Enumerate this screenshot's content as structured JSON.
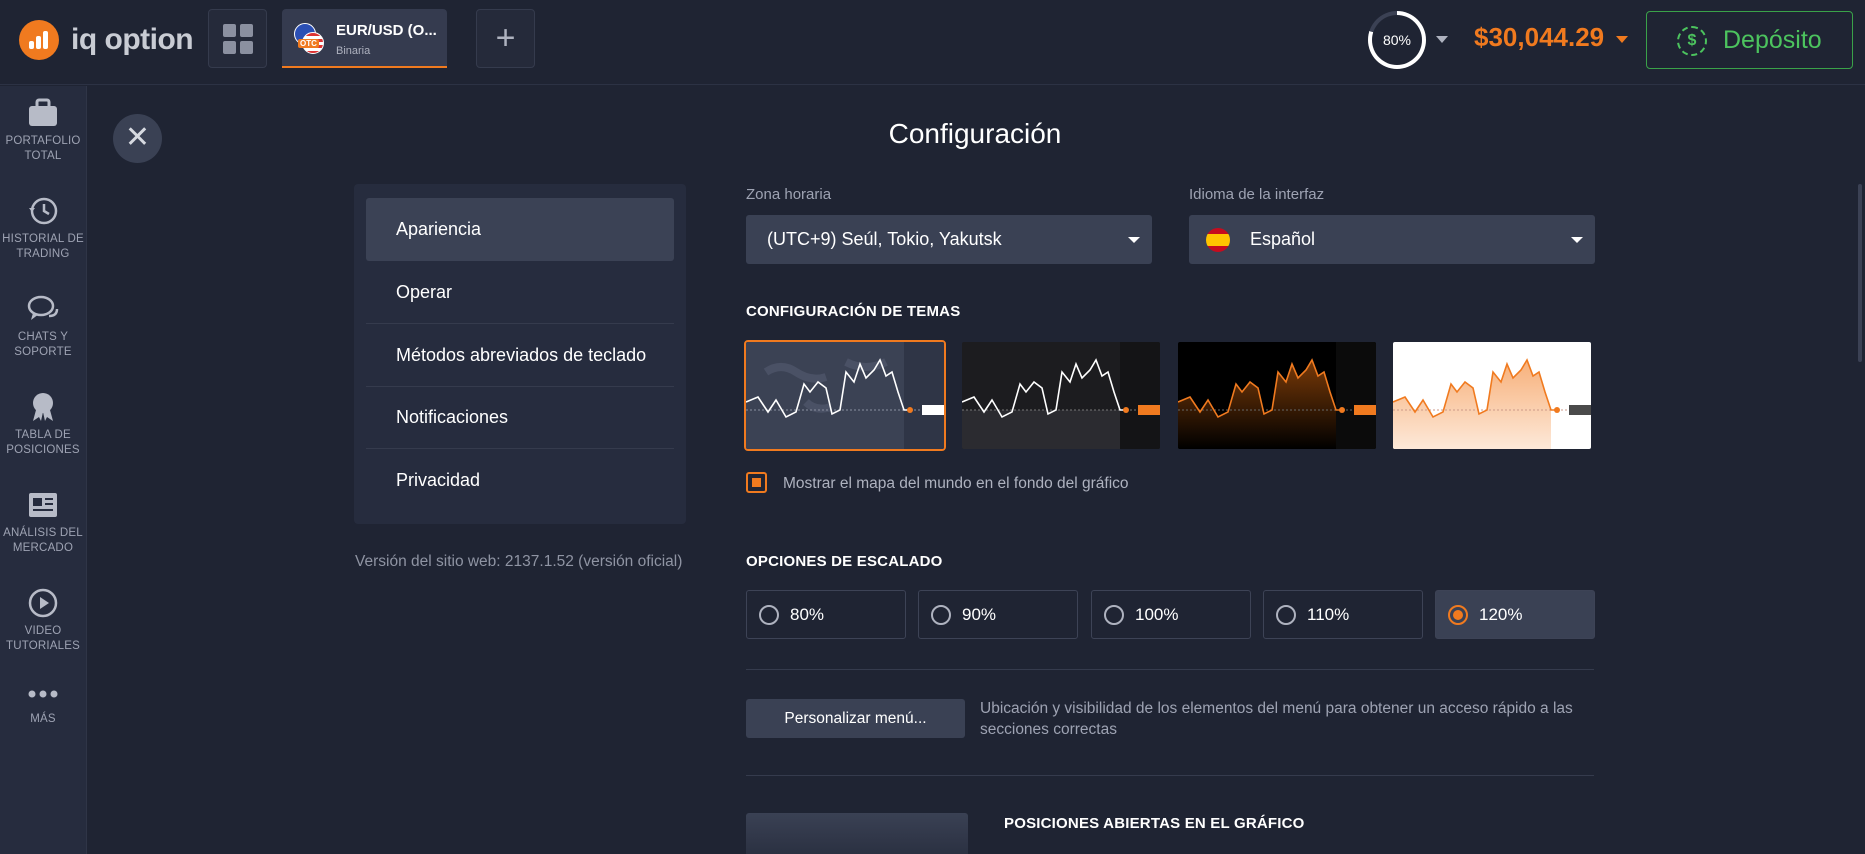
{
  "brand": {
    "name": "iq option"
  },
  "asset_tab": {
    "name": "EUR/USD (O...",
    "type": "Binaria",
    "badge": "OTC"
  },
  "header": {
    "progress_label": "80%",
    "progress_value": 0.8,
    "balance": "$30,044.29",
    "deposit_label": "Depósito"
  },
  "sidebar": {
    "items": [
      {
        "label_1": "PORTAFOLIO",
        "label_2": "TOTAL",
        "icon": "briefcase-icon"
      },
      {
        "label_1": "HISTORIAL DE",
        "label_2": "TRADING",
        "icon": "history-icon"
      },
      {
        "label_1": "CHATS Y",
        "label_2": "SOPORTE",
        "icon": "chat-icon"
      },
      {
        "label_1": "TABLA DE",
        "label_2": "POSICIONES",
        "icon": "award-icon"
      },
      {
        "label_1": "ANÁLISIS DEL",
        "label_2": "MERCADO",
        "icon": "newspaper-icon"
      },
      {
        "label_1": "VIDEO",
        "label_2": "TUTORIALES",
        "icon": "play-icon"
      },
      {
        "label_1": "MÁS",
        "label_2": "",
        "icon": "more-icon"
      }
    ]
  },
  "page": {
    "title": "Configuración",
    "version": "Versión del sitio web: 2137.1.52 (versión oficial)"
  },
  "menu": {
    "items": [
      {
        "label": "Apariencia",
        "active": true
      },
      {
        "label": "Operar"
      },
      {
        "label": "Métodos abreviados de teclado"
      },
      {
        "label": "Notificaciones"
      },
      {
        "label": "Privacidad"
      }
    ]
  },
  "timezone": {
    "label": "Zona horaria",
    "value": "(UTC+9) Seúl, Tokio, Yakutsk"
  },
  "language": {
    "label": "Idioma de la interfaz",
    "value": "Español"
  },
  "themes": {
    "heading": "CONFIGURACIÓN DE TEMAS",
    "selected": 0,
    "colors": [
      "#3b4254",
      "#1c1c1f",
      "#000000",
      "#ffffff"
    ]
  },
  "worldmap": {
    "label": "Mostrar el mapa del mundo en el fondo del gráfico",
    "checked": true
  },
  "scaling": {
    "heading": "OPCIONES DE ESCALADO",
    "options": [
      "80%",
      "90%",
      "100%",
      "110%",
      "120%"
    ],
    "selected": 4
  },
  "personalize": {
    "button": "Personalizar menú...",
    "description": "Ubicación y visibilidad de los elementos del menú para obtener un acceso rápido a las secciones correctas"
  },
  "positions": {
    "heading": "POSICIONES ABIERTAS EN EL GRÁFICO"
  },
  "colors": {
    "accent": "#f07a1f",
    "green": "#4cc35e",
    "bg": "#1f2433"
  }
}
